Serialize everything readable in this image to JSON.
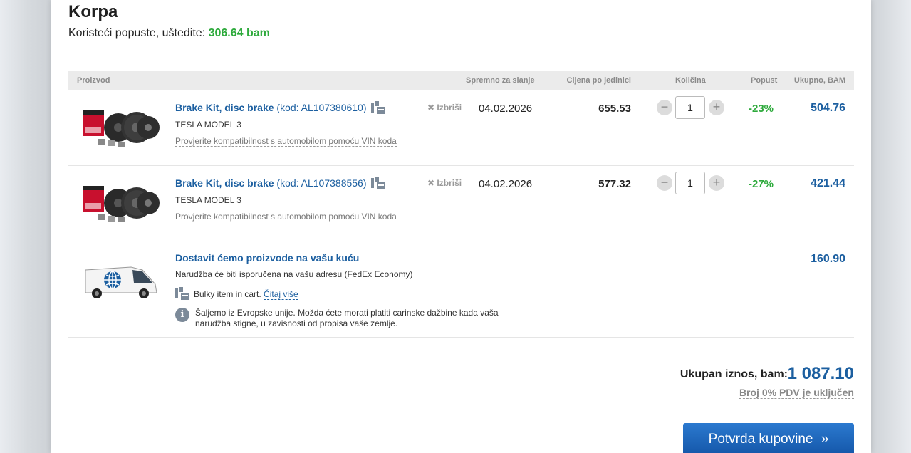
{
  "page": {
    "title": "Korpa",
    "savings_label": "Koristeći popuste, uštedite:",
    "savings_value": "306.64 bam"
  },
  "table": {
    "headers": {
      "product": "Proizvod",
      "ready": "Spremno za slanje",
      "unit_price": "Cijena po jedinici",
      "quantity": "Količina",
      "discount": "Popust",
      "total": "Ukupno, BAM"
    }
  },
  "items": [
    {
      "name": "Brake Kit, disc brake",
      "code": "(kod: AL107380610)",
      "car": "TESLA MODEL 3",
      "vin_link": "Provjerite kompatibilnost s automobilom pomoću VIN koda",
      "delete": "Izbriši",
      "ready_date": "04.02.2026",
      "unit_price": "655.53",
      "quantity": "1",
      "discount": "-23%",
      "total": "504.76"
    },
    {
      "name": "Brake Kit, disc brake",
      "code": "(kod: AL107388556)",
      "car": "TESLA MODEL 3",
      "vin_link": "Provjerite kompatibilnost s automobilom pomoću VIN koda",
      "delete": "Izbriši",
      "ready_date": "04.02.2026",
      "unit_price": "577.32",
      "quantity": "1",
      "discount": "-27%",
      "total": "421.44"
    }
  ],
  "shipping": {
    "title": "Dostavit ćemo proizvode na vašu kuću",
    "description": "Narudžba će biti isporučena na vašu adresu (FedEx Economy)",
    "bulky_text": "Bulky item in cart.",
    "bulky_link": "Čitaj više",
    "info_text": "Šaljemo iz Evropske unije. Možda ćete morati platiti carinske dažbine kada vaša narudžba stigne, u zavisnosti od propisa vaše zemlje.",
    "price": "160.90"
  },
  "summary": {
    "total_label": "Ukupan iznos, bam:",
    "total_value": "1 087.10",
    "vat_note": "Broj 0% PDV je uključen",
    "confirm_button": "Potvrda kupovine",
    "confirm_icon": "»"
  },
  "colors": {
    "accent_blue": "#1c5fa0",
    "discount_green": "#2eaa3c",
    "button_blue": "#1a63bb"
  }
}
